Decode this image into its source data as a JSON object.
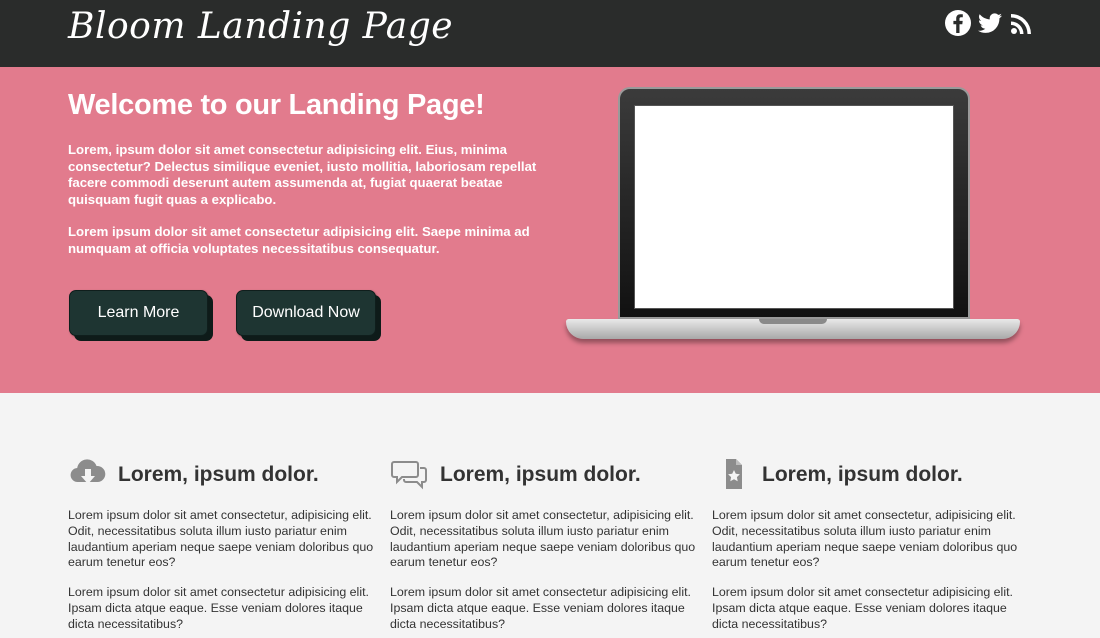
{
  "header": {
    "logo": "Bloom Landing Page",
    "social": [
      {
        "icon": "facebook-icon"
      },
      {
        "icon": "twitter-icon"
      },
      {
        "icon": "rss-icon"
      }
    ]
  },
  "hero": {
    "title": "Welcome to our Landing Page!",
    "paragraph1": "Lorem, ipsum dolor sit amet consectetur adipisicing elit. Eius, minima consectetur? Delectus similique eveniet, iusto mollitia, laboriosam repellat facere commodi deserunt autem assumenda at, fugiat quaerat beatae quisquam fugit quas a explicabo.",
    "paragraph2": "Lorem ipsum dolor sit amet consectetur adipisicing elit. Saepe minima ad numquam at officia voluptates necessitatibus consequatur.",
    "learn_more": "Learn More",
    "download_now": "Download Now"
  },
  "features": [
    {
      "icon": "cloud-download-icon",
      "title": "Lorem, ipsum dolor.",
      "p1": "Lorem ipsum dolor sit amet consectetur, adipisicing elit. Odit, necessitatibus soluta illum iusto pariatur enim laudantium aperiam neque saepe veniam doloribus quo earum tenetur eos?",
      "p2": "Lorem ipsum dolor sit amet consectetur adipisicing elit. Ipsam dicta atque eaque. Esse veniam dolores itaque dicta necessitatibus?"
    },
    {
      "icon": "chat-bubbles-icon",
      "title": "Lorem, ipsum dolor.",
      "p1": "Lorem ipsum dolor sit amet consectetur, adipisicing elit. Odit, necessitatibus soluta illum iusto pariatur enim laudantium aperiam neque saepe veniam doloribus quo earum tenetur eos?",
      "p2": "Lorem ipsum dolor sit amet consectetur adipisicing elit. Ipsam dicta atque eaque. Esse veniam dolores itaque dicta necessitatibus?"
    },
    {
      "icon": "file-star-icon",
      "title": "Lorem, ipsum dolor.",
      "p1": "Lorem ipsum dolor sit amet consectetur, adipisicing elit. Odit, necessitatibus soluta illum iusto pariatur enim laudantium aperiam neque saepe veniam doloribus quo earum tenetur eos?",
      "p2": "Lorem ipsum dolor sit amet consectetur adipisicing elit. Ipsam dicta atque eaque. Esse veniam dolores itaque dicta necessitatibus?"
    }
  ],
  "colors": {
    "header_bg": "#2a2c2b",
    "hero_bg": "#e27b8d",
    "button_bg": "#1e3532",
    "page_bg": "#f4f4f4"
  }
}
